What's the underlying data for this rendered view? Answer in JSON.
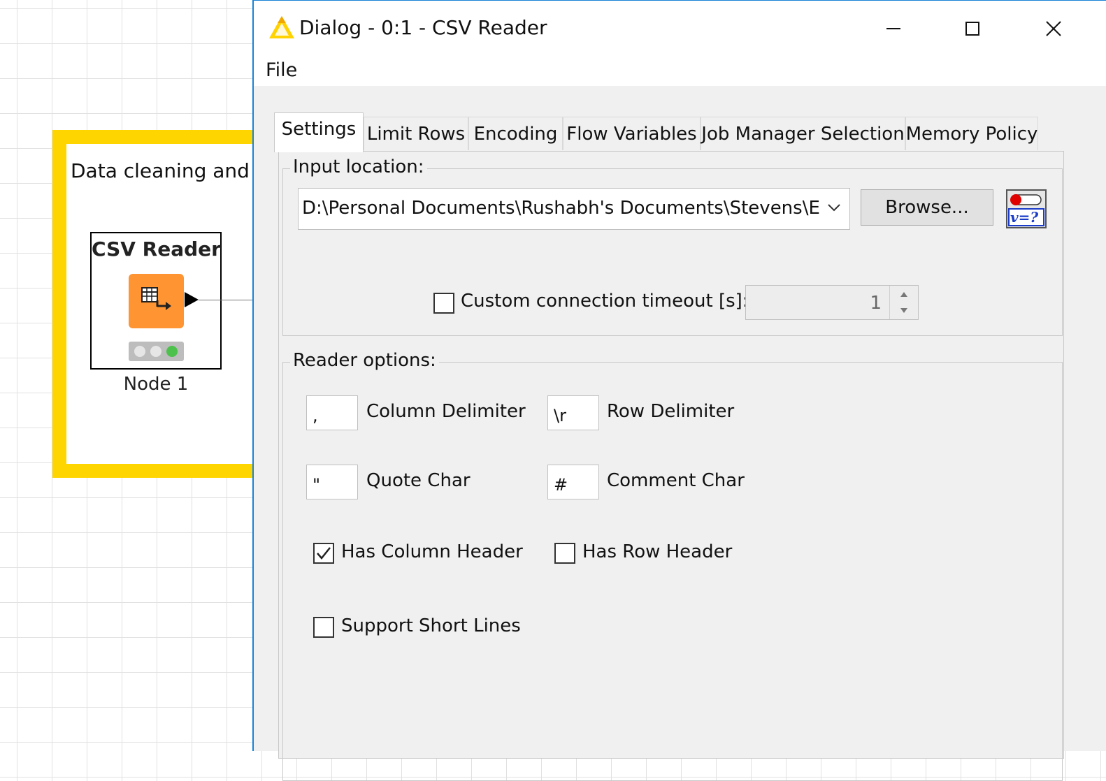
{
  "canvas": {
    "annotation_text": "Data cleaning and M",
    "node": {
      "title": "CSV Reader",
      "label": "Node 1",
      "icon": "table-arrow-icon",
      "status_colors": [
        "#e6e6e6",
        "#e6e6e6",
        "#4cc14c"
      ]
    },
    "annotation_color": "#ffd500",
    "node_color": "#ff9432"
  },
  "dialog": {
    "title": "Dialog - 0:1 - CSV Reader",
    "menu": [
      "File"
    ],
    "tabs": [
      {
        "label": "Settings",
        "active": true
      },
      {
        "label": "Limit Rows",
        "active": false
      },
      {
        "label": "Encoding",
        "active": false
      },
      {
        "label": "Flow Variables",
        "active": false
      },
      {
        "label": "Job Manager Selection",
        "active": false
      },
      {
        "label": "Memory Policy",
        "active": false
      }
    ],
    "input_location": {
      "group_label": "Input location:",
      "path": "D:\\Personal Documents\\Rushabh's Documents\\Stevens\\Engineering Management",
      "browse_label": "Browse...",
      "flow_var_button_text": "v=?",
      "timeout_checkbox_label": "Custom connection timeout [s]:",
      "timeout_checked": false,
      "timeout_value": "1"
    },
    "reader_options": {
      "group_label": "Reader options:",
      "column_delimiter_label": "Column Delimiter",
      "column_delimiter_value": ",",
      "row_delimiter_label": "Row Delimiter",
      "row_delimiter_value": "\\r",
      "quote_char_label": "Quote Char",
      "quote_char_value": "\"",
      "comment_char_label": "Comment Char",
      "comment_char_value": "#",
      "has_column_header_label": "Has Column Header",
      "has_column_header_checked": true,
      "has_row_header_label": "Has Row Header",
      "has_row_header_checked": false,
      "support_short_lines_label": "Support Short Lines",
      "support_short_lines_checked": false
    }
  }
}
